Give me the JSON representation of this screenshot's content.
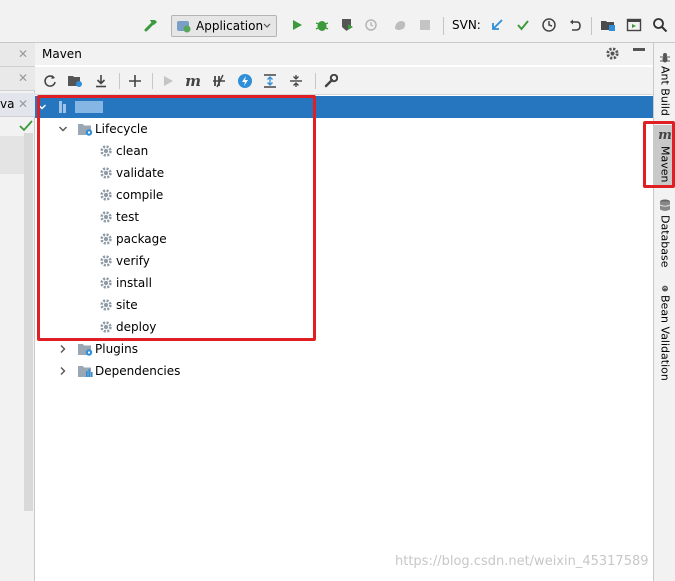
{
  "toolbar": {
    "run_config": "Application",
    "svn_label": "SVN:"
  },
  "maven": {
    "title": "Maven",
    "tree": {
      "project_name": "",
      "lifecycle_label": "Lifecycle",
      "lifecycle_goals": [
        "clean",
        "validate",
        "compile",
        "test",
        "package",
        "verify",
        "install",
        "site",
        "deploy"
      ],
      "plugins_label": "Plugins",
      "dependencies_label": "Dependencies"
    }
  },
  "left_strip": {
    "tab_fragment": "va"
  },
  "right_tabs": {
    "ant_build": "Ant Build",
    "maven": "Maven",
    "database": "Database",
    "bean_validation": "Bean Validation"
  },
  "watermark": "https://blog.csdn.net/weixin_45317589",
  "colors": {
    "selection": "#2675bf",
    "highlight_box": "#e01f24",
    "run_green": "#3c9a3c",
    "info_blue": "#2f8fd8"
  }
}
